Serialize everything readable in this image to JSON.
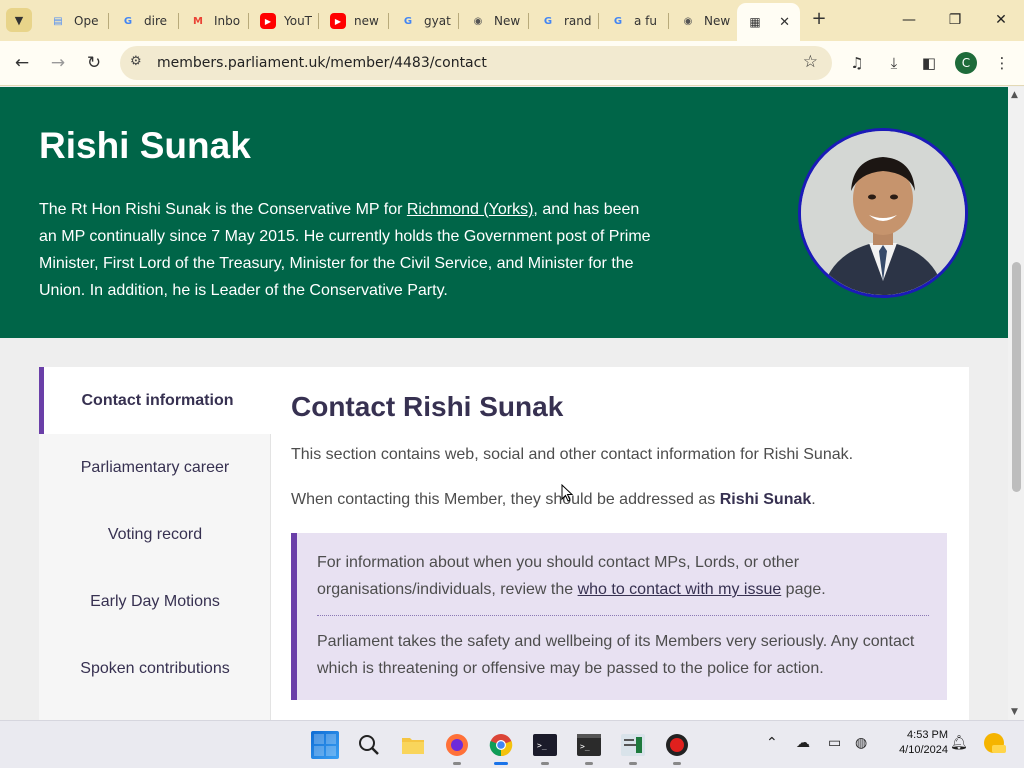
{
  "browser": {
    "tabs": [
      {
        "label": "Ope",
        "icon": "doc-icon",
        "color": "#4c8bf5"
      },
      {
        "label": "dire",
        "icon": "google-icon",
        "color": "#4285f4"
      },
      {
        "label": "Inbo",
        "icon": "gmail-icon",
        "color": "#ea4335"
      },
      {
        "label": "YouT",
        "icon": "youtube-icon",
        "color": "#ff0000"
      },
      {
        "label": "new",
        "icon": "youtube-icon",
        "color": "#ff0000"
      },
      {
        "label": "gyat",
        "icon": "google-icon",
        "color": "#4285f4"
      },
      {
        "label": "New",
        "icon": "chrome-icon",
        "color": "#555555"
      },
      {
        "label": "rand",
        "icon": "google-icon",
        "color": "#4285f4"
      },
      {
        "label": "a fu",
        "icon": "google-icon",
        "color": "#4285f4"
      },
      {
        "label": "New",
        "icon": "chrome-icon",
        "color": "#555555"
      }
    ],
    "active_tab": {
      "icon": "parliament-portcullis-icon",
      "close": "✕"
    },
    "new_tab": "+",
    "url": "members.parliament.uk/member/4483/contact",
    "profile_initial": "C"
  },
  "hero": {
    "name": "Rishi Sunak",
    "bio_pre": "The Rt Hon Rishi Sunak is the Conservative MP for ",
    "bio_link": "Richmond (Yorks)",
    "bio_post": ", and has been an MP continually since 7 May 2015. He currently holds the Government post of Prime Minister, First Lord of the Treasury, Minister for the Civil Service, and Minister for the Union. In addition, he is Leader of the Conservative Party."
  },
  "sidenav": {
    "items": [
      "Contact information",
      "Parliamentary career",
      "Voting record",
      "Early Day Motions",
      "Spoken contributions"
    ]
  },
  "content": {
    "title": "Contact Rishi Sunak",
    "intro": "This section contains web, social and other contact information for Rishi Sunak.",
    "address_pre": "When contacting this Member, they should be addressed as ",
    "address_name": "Rishi Sunak",
    "address_post": ".",
    "callout_1_pre": "For information about when you should contact MPs, Lords, or other organisations/individuals, review the ",
    "callout_1_link": "who to contact with my issue",
    "callout_1_post": " page.",
    "callout_2": "Parliament takes the safety and wellbeing of its Members very seriously. Any contact which is threatening or offensive may be passed to the police for action."
  },
  "taskbar": {
    "time": "4:53 PM",
    "date": "4/10/2024"
  },
  "colors": {
    "hero_green": "#006548",
    "accent_purple": "#6a3fa8",
    "callout_bg": "#e8e1f2",
    "heading_text": "#373151"
  }
}
